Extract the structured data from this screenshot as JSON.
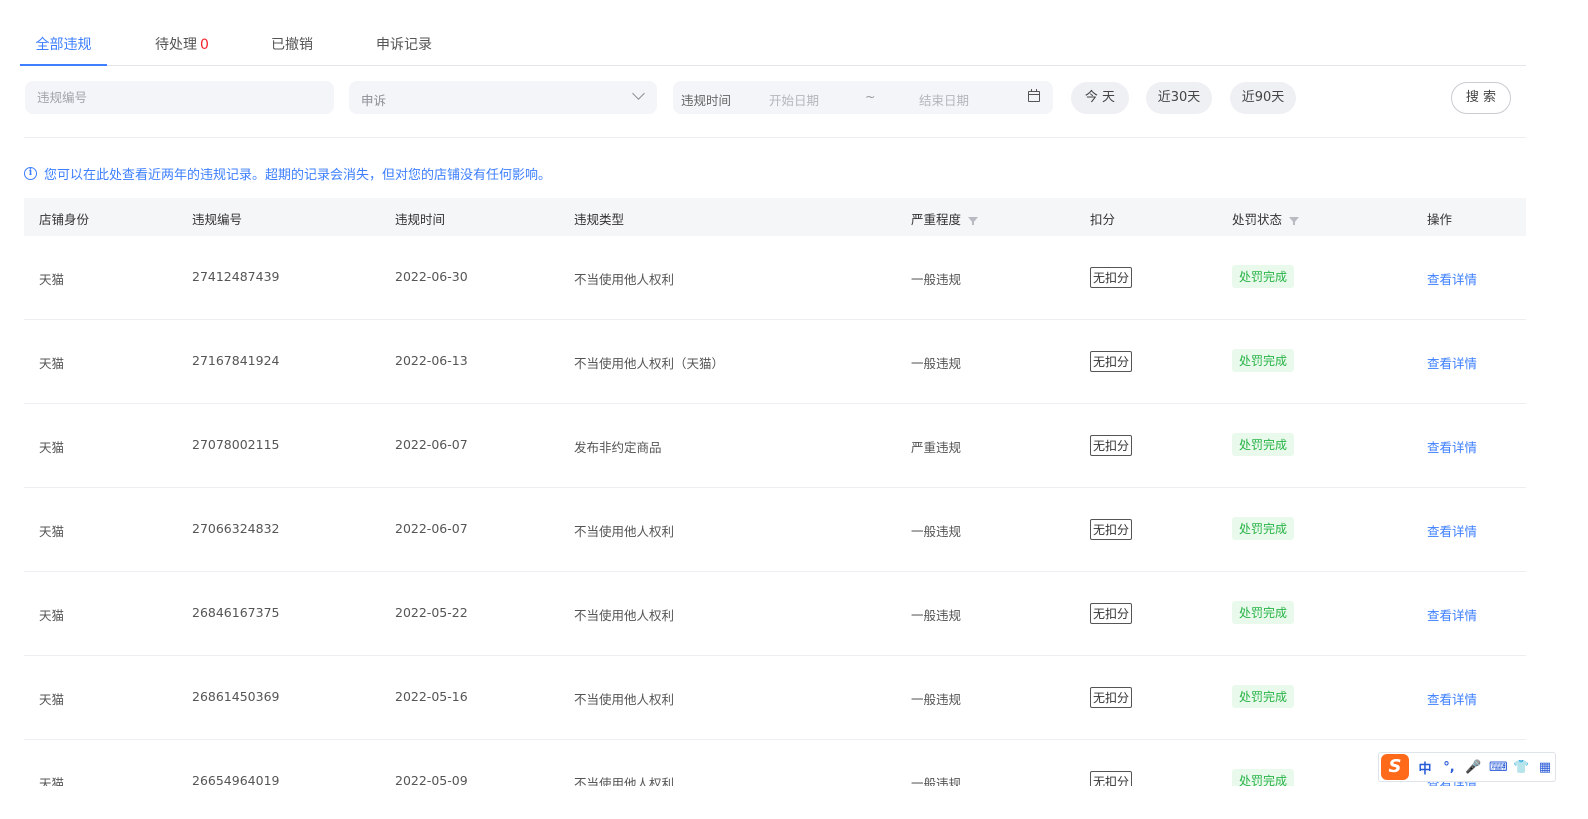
{
  "tabs": [
    {
      "label": "全部违规",
      "active": true
    },
    {
      "label": "待处理",
      "count": "0"
    },
    {
      "label": "已撤销"
    },
    {
      "label": "申诉记录"
    }
  ],
  "filters": {
    "code_placeholder": "违规编号",
    "select_value": "申诉",
    "date_label": "违规时间",
    "start_placeholder": "开始日期",
    "separator": "~",
    "end_placeholder": "结束日期",
    "quick": [
      "今 天",
      "近30天",
      "近90天"
    ],
    "search_label": "搜 索"
  },
  "notice": "您可以在此处查看近两年的违规记录。超期的记录会消失，但对您的店铺没有任何影响。",
  "table": {
    "headers": [
      "店铺身份",
      "违规编号",
      "违规时间",
      "违规类型",
      "严重程度",
      "扣分",
      "处罚状态",
      "操作"
    ],
    "rows": [
      {
        "shop": "天猫",
        "id": "27412487439",
        "date": "2022-06-30",
        "type": "不当使用他人权利",
        "severity": "一般违规",
        "points": "无扣分",
        "status": "处罚完成",
        "action": "查看详情"
      },
      {
        "shop": "天猫",
        "id": "27167841924",
        "date": "2022-06-13",
        "type": "不当使用他人权利（天猫）",
        "severity": "一般违规",
        "points": "无扣分",
        "status": "处罚完成",
        "action": "查看详情"
      },
      {
        "shop": "天猫",
        "id": "27078002115",
        "date": "2022-06-07",
        "type": "发布非约定商品",
        "severity": "严重违规",
        "points": "无扣分",
        "status": "处罚完成",
        "action": "查看详情"
      },
      {
        "shop": "天猫",
        "id": "27066324832",
        "date": "2022-06-07",
        "type": "不当使用他人权利",
        "severity": "一般违规",
        "points": "无扣分",
        "status": "处罚完成",
        "action": "查看详情"
      },
      {
        "shop": "天猫",
        "id": "26846167375",
        "date": "2022-05-22",
        "type": "不当使用他人权利",
        "severity": "一般违规",
        "points": "无扣分",
        "status": "处罚完成",
        "action": "查看详情"
      },
      {
        "shop": "天猫",
        "id": "26861450369",
        "date": "2022-05-16",
        "type": "不当使用他人权利",
        "severity": "一般违规",
        "points": "无扣分",
        "status": "处罚完成",
        "action": "查看详情"
      },
      {
        "shop": "天猫",
        "id": "26654964019",
        "date": "2022-05-09",
        "type": "不当使用他人权利",
        "severity": "一般违规",
        "points": "无扣分",
        "status": "处罚完成",
        "action": "查看详情"
      }
    ]
  },
  "ime": {
    "logo": "S",
    "items": [
      "中",
      "°,",
      "🎤",
      "⌨",
      "👕",
      "▦"
    ]
  },
  "colors": {
    "accent": "#3d7fff",
    "success": "#28b446",
    "danger": "#f5222d",
    "ime": "#ff6a1a"
  }
}
